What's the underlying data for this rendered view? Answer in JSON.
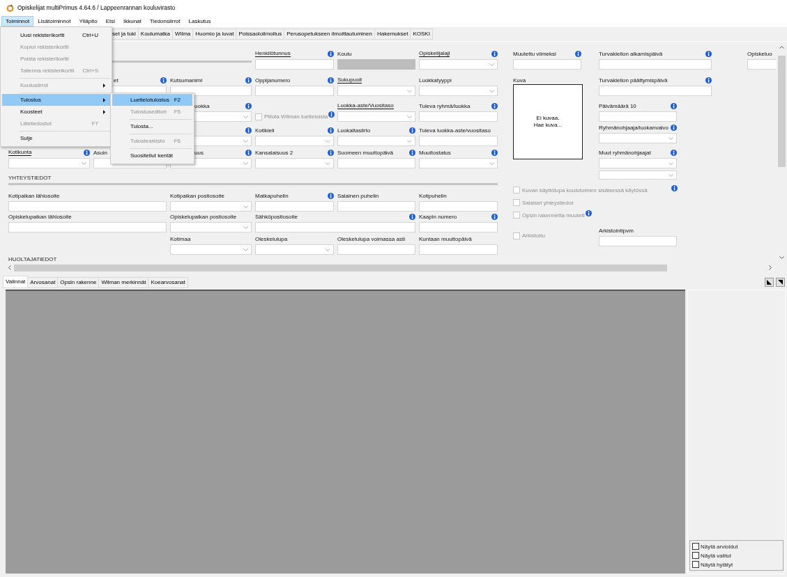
{
  "window": {
    "title": "Opiskelijat multiPrimus 4.64.6 / Lappeenrannan kouluvirasto"
  },
  "menubar": [
    {
      "label": "Toiminnot",
      "selected": true
    },
    {
      "label": "Lisätoiminnot",
      "selected": false
    },
    {
      "label": "Ylläpito",
      "selected": false
    },
    {
      "label": "Etsi",
      "selected": false
    },
    {
      "label": "Ikkunat",
      "selected": false
    },
    {
      "label": "Tiedonsiirrot",
      "selected": false
    },
    {
      "label": "Laskutus",
      "selected": false
    }
  ],
  "menu": [
    {
      "kind": "item",
      "label": "Uusi rekisterikortti",
      "shortcut": "Ctrl+U",
      "disabled": false,
      "selected": false,
      "submenu": false
    },
    {
      "kind": "item",
      "label": "Kopioi rekisterikortti",
      "disabled": true,
      "selected": false,
      "submenu": false
    },
    {
      "kind": "item",
      "label": "Poista rekisterikortti",
      "disabled": true,
      "selected": false,
      "submenu": false
    },
    {
      "kind": "item",
      "label": "Tallenna rekisterikortti",
      "shortcut": "Ctrl+S",
      "disabled": true,
      "selected": false,
      "submenu": false
    },
    {
      "kind": "separator"
    },
    {
      "kind": "item",
      "label": "Koulusiirrot",
      "disabled": true,
      "selected": false,
      "submenu": true
    },
    {
      "kind": "separator"
    },
    {
      "kind": "item",
      "label": "Tulostus",
      "disabled": false,
      "selected": true,
      "submenu": true
    },
    {
      "kind": "item",
      "label": "Koosteet",
      "disabled": false,
      "selected": false,
      "submenu": true
    },
    {
      "kind": "item",
      "label": "Liitetiedostot",
      "shortcut": "F7",
      "disabled": true,
      "selected": false,
      "submenu": false
    },
    {
      "kind": "separator"
    },
    {
      "kind": "item",
      "label": "Sulje",
      "disabled": false,
      "selected": false,
      "submenu": false
    }
  ],
  "submenu": [
    {
      "kind": "item",
      "label": "Luettelotulostus",
      "shortcut": "F2",
      "disabled": false,
      "selected": true
    },
    {
      "kind": "item",
      "label": "Tulostuseditori",
      "shortcut": "F5",
      "disabled": true,
      "selected": false
    },
    {
      "kind": "separator"
    },
    {
      "kind": "item",
      "label": "Tulosta...",
      "disabled": false,
      "selected": false
    },
    {
      "kind": "separator"
    },
    {
      "kind": "item",
      "label": "Tulostearkisto",
      "shortcut": "F6",
      "disabled": true,
      "selected": false
    },
    {
      "kind": "separator"
    },
    {
      "kind": "item",
      "label": "Suositellut kentät",
      "disabled": false,
      "selected": false
    }
  ],
  "tabs": [
    {
      "label": "set ja tuki",
      "selected": false
    },
    {
      "label": "Koulumatka",
      "selected": false
    },
    {
      "label": "Wilma",
      "selected": false
    },
    {
      "label": "Huomio ja luvat",
      "selected": false
    },
    {
      "label": "Poissaoloilmoitus",
      "selected": false
    },
    {
      "label": "Perusopetukseen ilmoittautuminen",
      "selected": false
    },
    {
      "label": "Hakemukset",
      "selected": false
    },
    {
      "label": "KOSKI",
      "selected": false
    }
  ],
  "form": {
    "rows": [
      {
        "kind": "fields",
        "fields": [
          {
            "label": "Henkilötunnus",
            "kind": "text",
            "required": true,
            "info": true
          },
          {
            "label": "Koulu",
            "kind": "readonly",
            "required": false
          },
          {
            "label": "Opiskelijalaji",
            "kind": "dropdown",
            "required": true,
            "info": true
          }
        ]
      },
      {
        "kind": "fields",
        "fields": [
          {
            "label": "et",
            "kind": "text",
            "required": false,
            "info": true
          },
          {
            "label": "Kutsumanimi",
            "kind": "text",
            "required": false,
            "info": true
          },
          {
            "label": "Oppijanumero",
            "kind": "text",
            "required": false,
            "info": true
          },
          {
            "label": "Sukupuoli",
            "kind": "dropdown",
            "required": true
          },
          {
            "label": "Luokkatyyppi",
            "kind": "dropdown",
            "required": false
          }
        ]
      },
      {
        "kind": "fields",
        "fields": [
          {
            "label": "uokka",
            "kind": "dropdown",
            "required": false,
            "info": true
          },
          {
            "label": "Piilota Wilman luetteloista",
            "kind": "checkbox",
            "checked": false,
            "disabled": true,
            "info": true
          },
          {
            "label": "Luokka-aste/Vuositaso",
            "kind": "dropdown",
            "required": true
          },
          {
            "label": "Tuleva ryhmä/luokka",
            "kind": "text",
            "required": false,
            "info": true
          }
        ]
      },
      {
        "kind": "fields",
        "fields": [
          {
            "kind": "dropdown",
            "info": true
          },
          {
            "label": "Kotikieli",
            "kind": "dropdown",
            "required": false,
            "info": true
          },
          {
            "label": "Luokaltasiirto",
            "kind": "dropdown",
            "required": false,
            "info": true
          },
          {
            "label": "Tuleva luokka-aste/vuositaso",
            "kind": "text",
            "required": false
          }
        ]
      },
      {
        "kind": "fields",
        "fields": [
          {
            "label": "Kotikunta",
            "kind": "dropdown",
            "required": true,
            "info": true
          },
          {
            "label": "Asuin",
            "kind": "text",
            "required": false
          },
          {
            "label": "uus",
            "kind": "dropdown",
            "required": false,
            "info": true
          },
          {
            "label": "Kansalaisuus 2",
            "kind": "dropdown",
            "required": false,
            "info": true
          },
          {
            "label": "Suomeen muuttopäivä",
            "kind": "text",
            "required": false,
            "info": true
          },
          {
            "label": "Muuttostatus",
            "kind": "dropdown",
            "required": false,
            "info": true
          }
        ]
      },
      {
        "kind": "section",
        "title": "YHTEYSTIEDOT"
      },
      {
        "kind": "fields",
        "fields": [
          {
            "label": "Kotipaikan lähiosoite",
            "kind": "text",
            "required": false
          },
          {
            "label": "Kotipaikan postiosoite",
            "kind": "dropdown",
            "required": false
          },
          {
            "label": "Matkapuhelin",
            "kind": "text",
            "required": false,
            "info": true
          },
          {
            "label": "Salainen puhelin",
            "kind": "text",
            "required": false
          },
          {
            "label": "Kotipuhelin",
            "kind": "text",
            "required": false
          }
        ]
      },
      {
        "kind": "fields",
        "fields": [
          {
            "label": "Opiskelupaikan lähiosoite",
            "kind": "text",
            "required": false
          },
          {
            "label": "Opiskelupaikan postiosoite",
            "kind": "dropdown",
            "required": false
          },
          {
            "label": "Sähköpostiosoite",
            "kind": "text",
            "required": false,
            "info": true
          },
          {
            "label": "Kaapin numero",
            "kind": "text",
            "required": false,
            "info": true
          }
        ]
      },
      {
        "kind": "fields",
        "fields": [
          {
            "label": "Kotimaa",
            "kind": "dropdown",
            "required": false
          },
          {
            "label": "Oleskelulupa",
            "kind": "dropdown",
            "required": false
          },
          {
            "label": "Oleskelulupa voimassa asti",
            "kind": "text",
            "required": false
          },
          {
            "label": "Kuntaan muuttopäivä",
            "kind": "text",
            "required": false
          }
        ]
      },
      {
        "kind": "section",
        "title": "HUOLTAJATIEDOT"
      }
    ]
  },
  "side": {
    "columns": [
      [
        {
          "label": "Muutettu viimeksi",
          "kind": "text",
          "info": true
        },
        {
          "label": "Kuva",
          "kind": "photo",
          "text": "Ei kuvaa.\nHae kuva..."
        }
      ],
      [
        {
          "label": "Turvakiellon alkamispäivä",
          "kind": "text",
          "info": true
        },
        {
          "label": "Turvakiellon päättymispäivä",
          "kind": "text",
          "info": true
        },
        {
          "label": "Päivämäärä 10",
          "kind": "text",
          "info": true
        },
        {
          "label": "Ryhmänohjaaja/luokanvalvo",
          "kind": "dropdown",
          "info": true
        },
        {
          "label": "Muut ryhmänohjaajat",
          "kind": "dropdown",
          "info": true
        },
        {
          "kind": "dropdown"
        }
      ],
      [
        {
          "label": "Opiskeluo",
          "kind": "text"
        }
      ]
    ],
    "checks": [
      {
        "label": "Kuvan käyttölupa koulutoimen sisäisessä käytössä",
        "checked": false,
        "disabled": true,
        "info": true
      },
      {
        "label": "Salaiset yhteystiedot",
        "checked": false,
        "disabled": true
      },
      {
        "label": "Opsin rakennetta muutett",
        "checked": false,
        "disabled": true,
        "info": true
      },
      {
        "label": "Arkistoitu",
        "checked": false,
        "disabled": true
      }
    ],
    "archive": {
      "label": "Arkistointipvm",
      "kind": "text"
    }
  },
  "bottom_tabs": [
    {
      "label": "Valinnat",
      "selected": true
    },
    {
      "label": "Arvosanat",
      "selected": false
    },
    {
      "label": "Opsin rakenne",
      "selected": false
    },
    {
      "label": "Wilman merkinnät",
      "selected": false
    },
    {
      "label": "Koearvosanat",
      "selected": false
    }
  ],
  "filters": [
    {
      "label": "Näytä arvioidut",
      "checked": false
    },
    {
      "label": "Näytä valitut",
      "checked": false
    },
    {
      "label": "Näytä hylätyt",
      "checked": false
    }
  ]
}
